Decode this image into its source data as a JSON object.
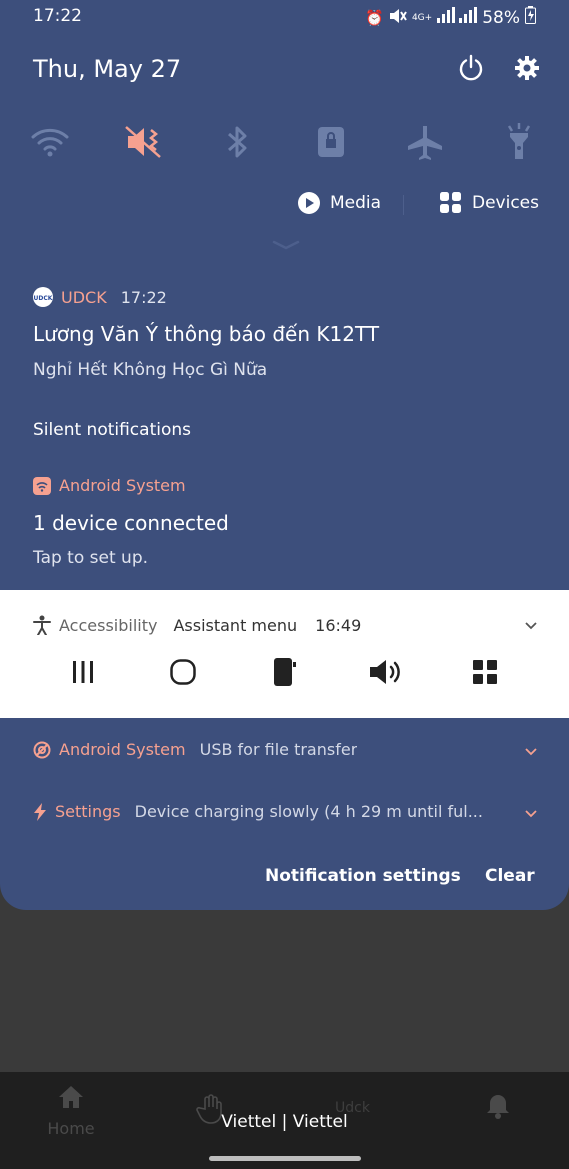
{
  "status_bar": {
    "time": "17:22",
    "network": "4G+",
    "battery": "58%"
  },
  "header": {
    "date": "Thu, May 27"
  },
  "quick_settings": {
    "tiles": [
      "wifi-icon",
      "mute-icon",
      "bluetooth-icon",
      "screen-lock-icon",
      "airplane-icon",
      "flashlight-icon"
    ]
  },
  "media": {
    "media_label": "Media",
    "devices_label": "Devices"
  },
  "notifications": {
    "udck": {
      "app": "UDCK",
      "time": "17:22",
      "title": "Lương Văn Ý thông báo đến K12TT",
      "body": "Nghỉ Hết Không Học Gì Nữa"
    },
    "silent_header": "Silent notifications",
    "android_system": {
      "app": "Android System",
      "title": "1 device connected",
      "body": "Tap to set up."
    },
    "accessibility": {
      "app": "Accessibility",
      "title": "Assistant menu",
      "time": "16:49"
    },
    "usb": {
      "app": "Android System",
      "desc": "USB for file transfer"
    },
    "settings": {
      "app": "Settings",
      "desc": "Device charging slowly (4 h 29 m until ful..."
    }
  },
  "footer": {
    "notification_settings": "Notification settings",
    "clear": "Clear"
  },
  "background_app": {
    "home_tab": "Home",
    "middle_tab": "Udck",
    "carrier": "Viettel | Viettel"
  },
  "colors": {
    "shade": "#3d4f7c",
    "accent": "#f6a190"
  }
}
